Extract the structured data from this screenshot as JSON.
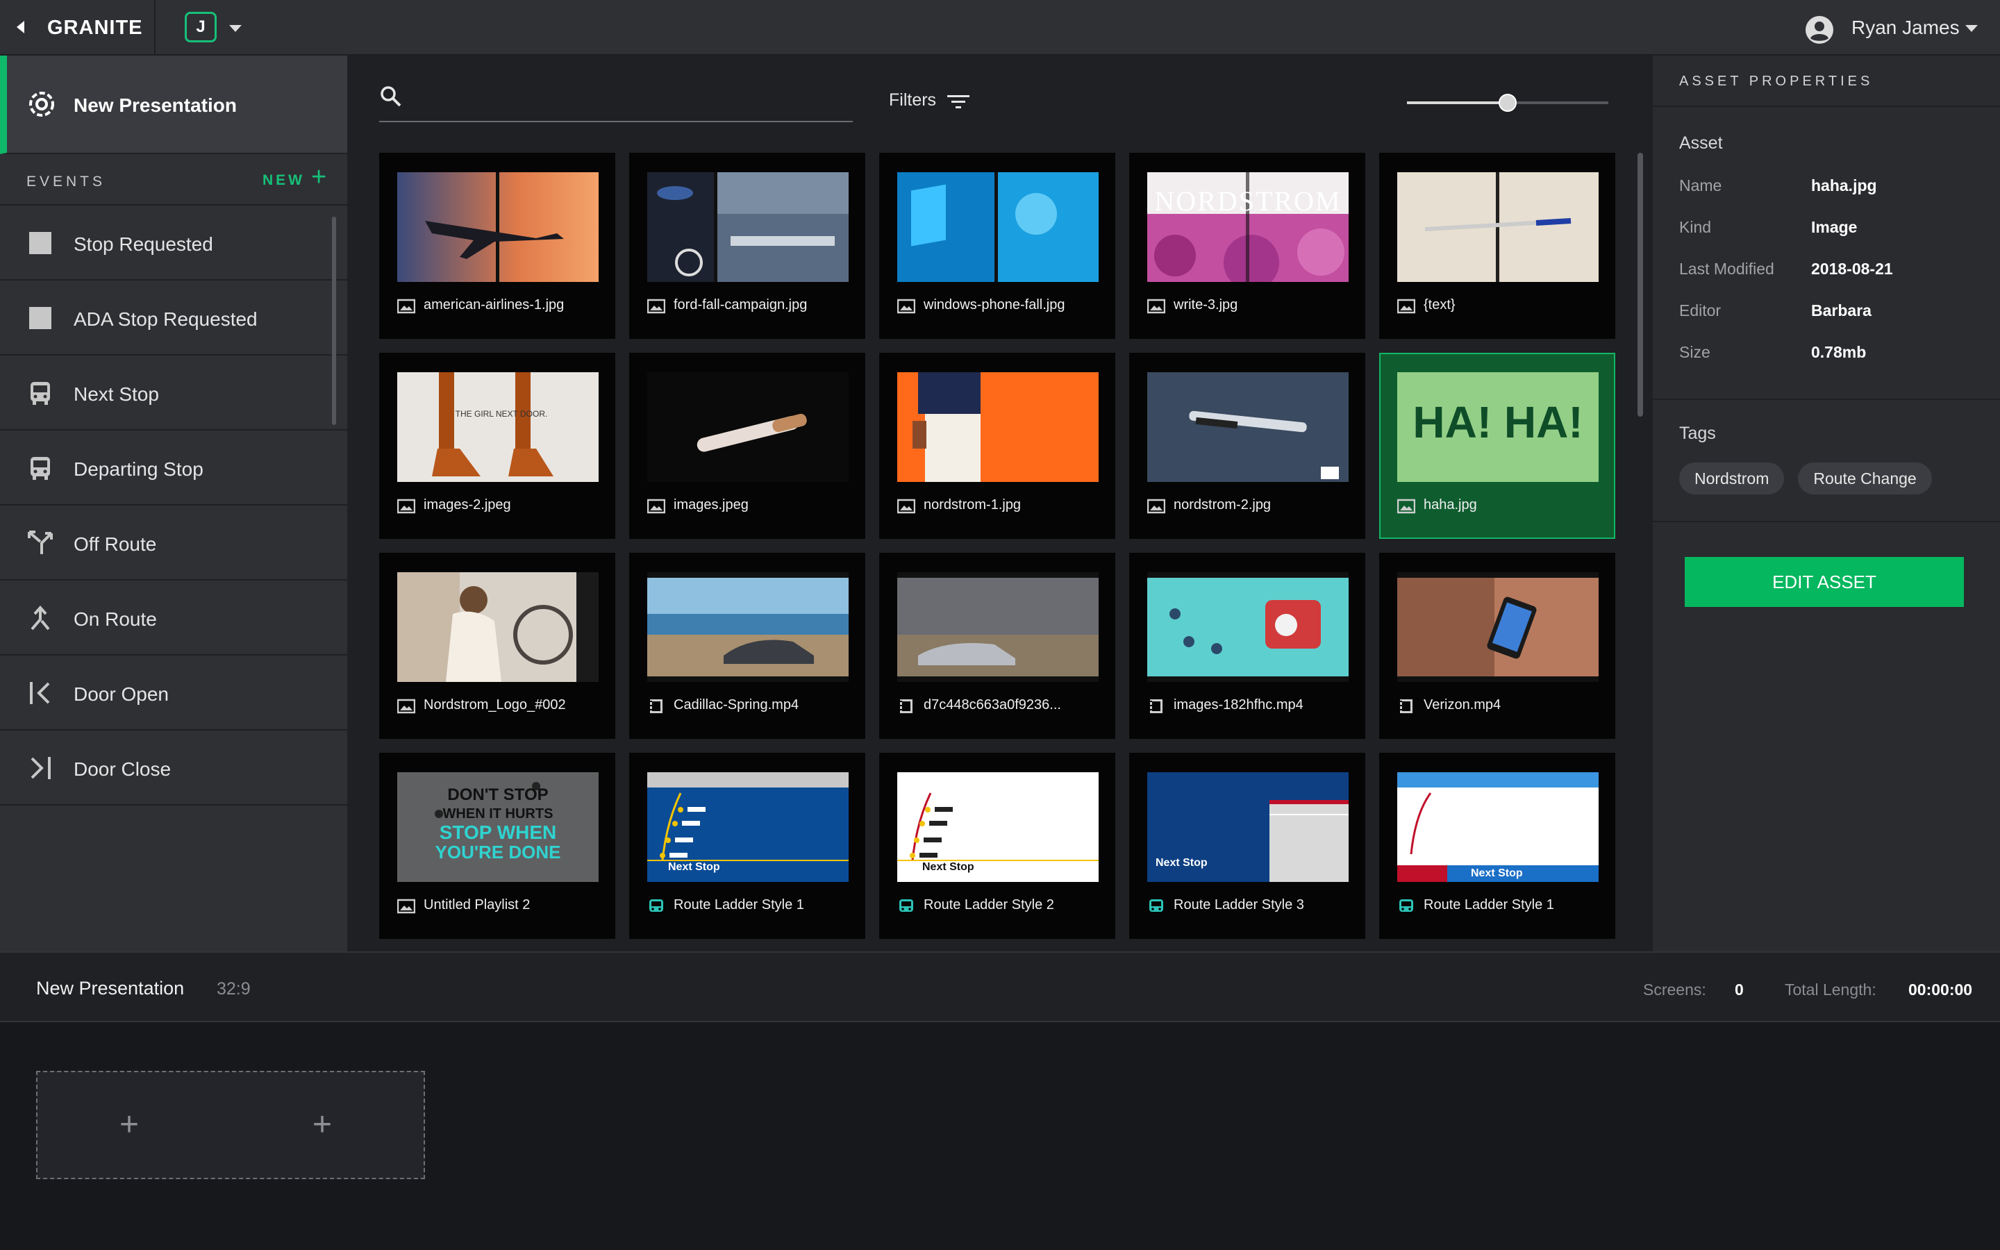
{
  "app": {
    "brand": "GRANITE",
    "project_initial": "J",
    "user_name": "Ryan James"
  },
  "sidebar": {
    "presentation": "New Presentation",
    "events_title": "EVENTS",
    "new_label": "NEW",
    "events": [
      {
        "label": "Stop Requested",
        "icon": "square-icon"
      },
      {
        "label": "ADA Stop Requested",
        "icon": "square-icon"
      },
      {
        "label": "Next Stop",
        "icon": "bus-icon"
      },
      {
        "label": "Departing Stop",
        "icon": "bus-icon"
      },
      {
        "label": "Off Route",
        "icon": "fork-route-icon"
      },
      {
        "label": "On Route",
        "icon": "merge-route-icon"
      },
      {
        "label": "Door Open",
        "icon": "door-open-icon"
      },
      {
        "label": "Door Close",
        "icon": "door-close-icon"
      }
    ]
  },
  "toolbar": {
    "search_placeholder": "",
    "filters_label": "Filters",
    "zoom_level": 0.5
  },
  "assets": [
    {
      "name": "american-airlines-1.jpg",
      "type": "image",
      "thumb": "airplane"
    },
    {
      "name": "ford-fall-campaign.jpg",
      "type": "image",
      "thumb": "ford"
    },
    {
      "name": "windows-phone-fall.jpg",
      "type": "image",
      "thumb": "windows"
    },
    {
      "name": "write-3.jpg",
      "type": "image",
      "thumb": "nordstrom",
      "thumb_text": "NORDSTROM"
    },
    {
      "name": "{text}",
      "type": "image",
      "thumb": "pen"
    },
    {
      "name": "images-2.jpeg",
      "type": "image",
      "thumb": "boots",
      "thumb_text": "THE GIRL NEXT DOOR."
    },
    {
      "name": "images.jpeg",
      "type": "image",
      "thumb": "cigar"
    },
    {
      "name": "nordstrom-1.jpg",
      "type": "image",
      "thumb": "orange"
    },
    {
      "name": "nordstrom-2.jpg",
      "type": "image",
      "thumb": "pen-dark"
    },
    {
      "name": "haha.jpg",
      "type": "image",
      "thumb": "haha",
      "thumb_text": "HA! HA!",
      "selected": true
    },
    {
      "name": "Nordstrom_Logo_#002",
      "type": "image",
      "thumb": "woman"
    },
    {
      "name": "Cadillac-Spring.mp4",
      "type": "video",
      "thumb": "car-coast"
    },
    {
      "name": "d7c448c663a0f9236...",
      "type": "video",
      "thumb": "car-beach"
    },
    {
      "name": "images-182hfhc.mp4",
      "type": "video",
      "thumb": "radio"
    },
    {
      "name": "Verizon.mp4",
      "type": "video",
      "thumb": "phone-hand"
    },
    {
      "name": "Untitled Playlist 2",
      "type": "image",
      "thumb": "dont-stop",
      "thumb_text": "DON'T STOP WHEN IT HURTS STOP WHEN YOU'RE DONE"
    },
    {
      "name": "Route Ladder Style 1",
      "type": "route",
      "thumb": "ladder-blue",
      "thumb_text": "Next Stop"
    },
    {
      "name": "Route Ladder Style 2",
      "type": "route",
      "thumb": "ladder-white",
      "thumb_text": "Next Stop"
    },
    {
      "name": "Route Ladder Style 3",
      "type": "route",
      "thumb": "ladder-3",
      "thumb_text": "Next Stop"
    },
    {
      "name": "Route Ladder Style 1",
      "type": "route",
      "thumb": "ladder-4",
      "thumb_text": "Next Stop"
    }
  ],
  "properties": {
    "title": "ASSET PROPERTIES",
    "section": "Asset",
    "rows": [
      {
        "key": "Name",
        "value": "haha.jpg"
      },
      {
        "key": "Kind",
        "value": "Image"
      },
      {
        "key": "Last Modified",
        "value": "2018-08-21"
      },
      {
        "key": "Editor",
        "value": "Barbara"
      },
      {
        "key": "Size",
        "value": "0.78mb"
      }
    ],
    "tags_label": "Tags",
    "tags": [
      "Nordstrom",
      "Route Change"
    ],
    "edit_button": "EDIT ASSET"
  },
  "bottom": {
    "title": "New Presentation",
    "ratio": "32:9",
    "screens_label": "Screens:",
    "screens_value": "0",
    "length_label": "Total Length:",
    "length_value": "00:00:00",
    "slots": [
      "+",
      "+"
    ]
  },
  "colors": {
    "accent": "#16c079",
    "button": "#05b75f",
    "selected_tile": "#0f5d2f"
  }
}
